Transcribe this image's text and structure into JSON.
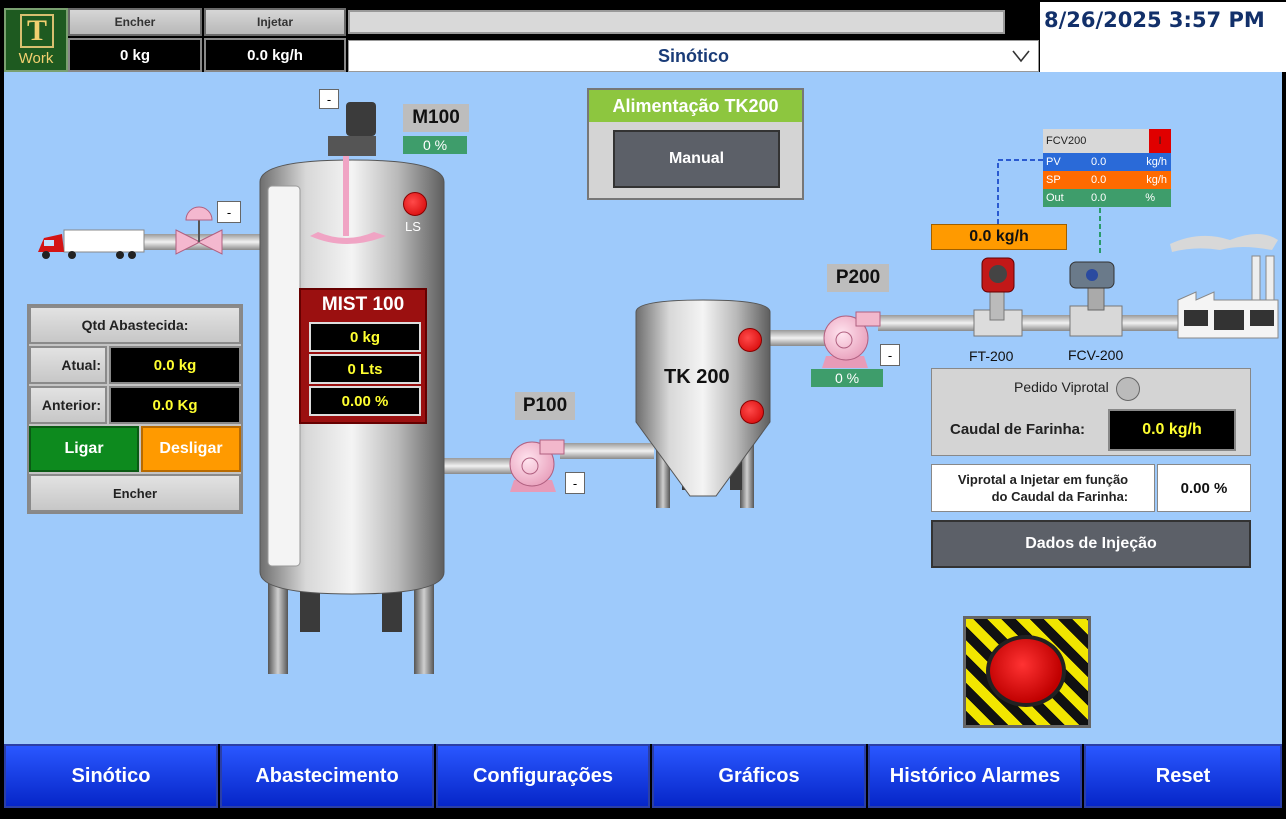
{
  "header": {
    "logo_letter": "T",
    "logo_word": "Work",
    "encher_label": "Encher",
    "injetar_label": "Injetar",
    "encher_value": "0 kg",
    "injetar_value": "0.0 kg/h",
    "screen_selected": "Sinótico",
    "datetime": "8/26/2025 3:57 PM"
  },
  "mixer": {
    "motor_label": "M100",
    "motor_pct": "0 %",
    "ls_label": "LS",
    "mist_title": "MIST 100",
    "mist_kg": "0 kg",
    "mist_lts": "0 Lts",
    "mist_pct": "0.00 %",
    "valve_button": "-",
    "motor_button": "-"
  },
  "pumps": {
    "p100_label": "P100",
    "p100_button": "-",
    "p200_label": "P200",
    "p200_button": "-",
    "p200_pct": "0 %"
  },
  "tank": {
    "label": "TK 200"
  },
  "alimentacao": {
    "title": "Alimentação TK200",
    "mode_button": "Manual"
  },
  "qtd": {
    "title": "Qtd Abastecida:",
    "atual_label": "Atual:",
    "atual_value": "0.0 kg",
    "anterior_label": "Anterior:",
    "anterior_value": "0.0 Kg",
    "ligar": "Ligar",
    "desligar": "Desligar",
    "encher": "Encher"
  },
  "flow": {
    "ft_value": "0.0 kg/h",
    "ft_label": "FT-200",
    "fcv_label": "FCV-200"
  },
  "faceplate": {
    "tag": "FCV200",
    "mode": "I",
    "pv_label": "PV",
    "pv_value": "0.0",
    "pv_unit": "kg/h",
    "sp_label": "SP",
    "sp_value": "0.0",
    "sp_unit": "kg/h",
    "out_label": "Out",
    "out_value": "0.0",
    "out_unit": "%"
  },
  "pedido": {
    "label": "Pedido Viprotal",
    "caudal_label": "Caudal de Farinha:",
    "caudal_value": "0.0 kg/h",
    "viprotal_line1": "Viprotal a Injetar em função",
    "viprotal_line2": "do Caudal da Farinha:",
    "viprotal_value": "0.00 %",
    "dados_button": "Dados de Injeção"
  },
  "nav": {
    "items": [
      "Sinótico",
      "Abastecimento",
      "Configurações",
      "Gráficos",
      "Histórico Alarmes",
      "Reset"
    ]
  },
  "colors": {
    "background": "#9ecafb",
    "nav_blue": "#0a2ee6",
    "ligar_green": "#0d8a1e",
    "desligar_orange": "#ff9a00",
    "alarm_red": "#e00000"
  }
}
